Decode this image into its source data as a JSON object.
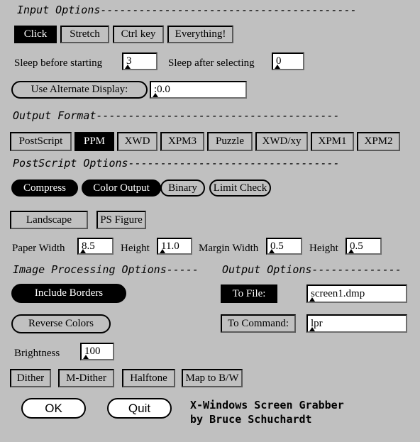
{
  "app": {
    "background": "#c0c0c0",
    "selected_color": "#000000",
    "selected_text_color": "#ffffff",
    "field_background": "#ffffff"
  },
  "sections": {
    "input_options": "Input Options----------------------------------------",
    "output_format": "Output Format--------------------------------------",
    "postscript_options": "PostScript Options---------------------------------",
    "image_processing_options": "Image Processing Options-----",
    "output_options": "Output Options--------------"
  },
  "input": {
    "modes": [
      {
        "label": "Click",
        "selected": true
      },
      {
        "label": "Stretch",
        "selected": false
      },
      {
        "label": "Ctrl key",
        "selected": false
      },
      {
        "label": "Everything!",
        "selected": false
      }
    ],
    "sleep_before_label": "Sleep before starting",
    "sleep_before_value": "3",
    "sleep_after_label": "Sleep after selecting",
    "sleep_after_value": "0",
    "alt_display_label": "Use Alternate Display:",
    "alt_display_selected": false,
    "alt_display_value": ":0.0"
  },
  "output_format": {
    "formats": [
      {
        "label": "PostScript",
        "selected": false
      },
      {
        "label": "PPM",
        "selected": true
      },
      {
        "label": "XWD",
        "selected": false
      },
      {
        "label": "XPM3",
        "selected": false
      },
      {
        "label": "Puzzle",
        "selected": false
      },
      {
        "label": "XWD/xy",
        "selected": false
      },
      {
        "label": "XPM1",
        "selected": false
      },
      {
        "label": "XPM2",
        "selected": false
      }
    ]
  },
  "postscript": {
    "toggles": [
      {
        "label": "Compress",
        "selected": true
      },
      {
        "label": "Color Output",
        "selected": true
      },
      {
        "label": "Binary",
        "selected": false
      },
      {
        "label": "Limit Check",
        "selected": false
      }
    ],
    "orientation": [
      {
        "label": "Landscape",
        "selected": false
      },
      {
        "label": "PS Figure",
        "selected": false
      }
    ],
    "paper_width_label": "Paper Width",
    "paper_width_value": "8.5",
    "paper_height_label": "Height",
    "paper_height_value": "11.0",
    "margin_width_label": "Margin Width",
    "margin_width_value": "0.5",
    "margin_height_label": "Height",
    "margin_height_value": "0.5"
  },
  "image_processing": {
    "include_borders_label": "Include Borders",
    "include_borders_selected": true,
    "reverse_colors_label": "Reverse Colors",
    "reverse_colors_selected": false,
    "brightness_label": "Brightness",
    "brightness_value": "100",
    "dither_buttons": [
      {
        "label": "Dither",
        "selected": false
      },
      {
        "label": "M-Dither",
        "selected": false
      },
      {
        "label": "Halftone",
        "selected": false
      },
      {
        "label": "Map to B/W",
        "selected": false
      }
    ]
  },
  "output": {
    "to_file_label": "To File:",
    "to_file_selected": true,
    "to_file_value": "screen1.dmp",
    "to_command_label": "To Command:",
    "to_command_selected": false,
    "to_command_value": "lpr"
  },
  "actions": {
    "ok_label": "OK",
    "quit_label": "Quit"
  },
  "credit": {
    "line1": "X-Windows Screen Grabber",
    "line2": "by Bruce Schuchardt"
  }
}
